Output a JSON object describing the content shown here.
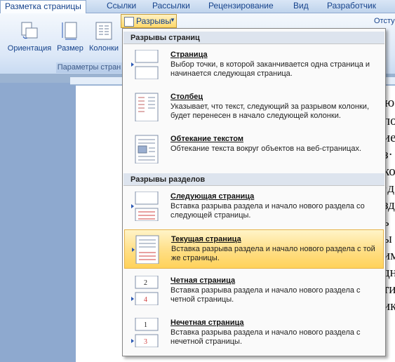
{
  "tabs": [
    "Разметка страницы",
    "Ссылки",
    "Рассылки",
    "Рецензирование",
    "Вид",
    "Разработчик"
  ],
  "ribbon": {
    "buttons": [
      "Ориентация",
      "Размер",
      "Колонки"
    ],
    "group_label": "Параметры стран",
    "right_label": "Отсту",
    "breaks_button": "Разрывы"
  },
  "menu": {
    "section1": "Разрывы страниц",
    "items1": [
      {
        "title": "Страница",
        "desc": "Выбор точки, в которой заканчивается одна страница и начинается следующая страница."
      },
      {
        "title": "Столбец",
        "desc": "Указывает, что текст, следующий за разрывом колонки, будет перенесен в начало следующей колонки."
      },
      {
        "title": "Обтекание текстом",
        "desc": "Обтекание текста вокруг объектов на веб-страницах."
      }
    ],
    "section2": "Разрывы разделов",
    "items2": [
      {
        "title": "Следующая страница",
        "desc": "Вставка разрыва раздела и начало нового раздела со следующей страницы."
      },
      {
        "title": "Текущая страница",
        "desc": "Вставка разрыва раздела и начало нового раздела с той же страницы."
      },
      {
        "title": "Четная страница",
        "desc": "Вставка разрыва раздела и начало нового раздела с четной страницы."
      },
      {
        "title": "Нечетная страница",
        "desc": "Вставка разрыва раздела и начало нового раздела с нечетной страницы."
      }
    ]
  },
  "background_text": [
    "ю",
    "по",
    "иед",
    "з·",
    "ко",
    "·д",
    "зд",
    "ь",
    "ы",
    "им",
    "дн",
    "ти",
    "ик"
  ],
  "colors": {
    "accent": "#15428b",
    "highlight": "#ffd86a"
  }
}
